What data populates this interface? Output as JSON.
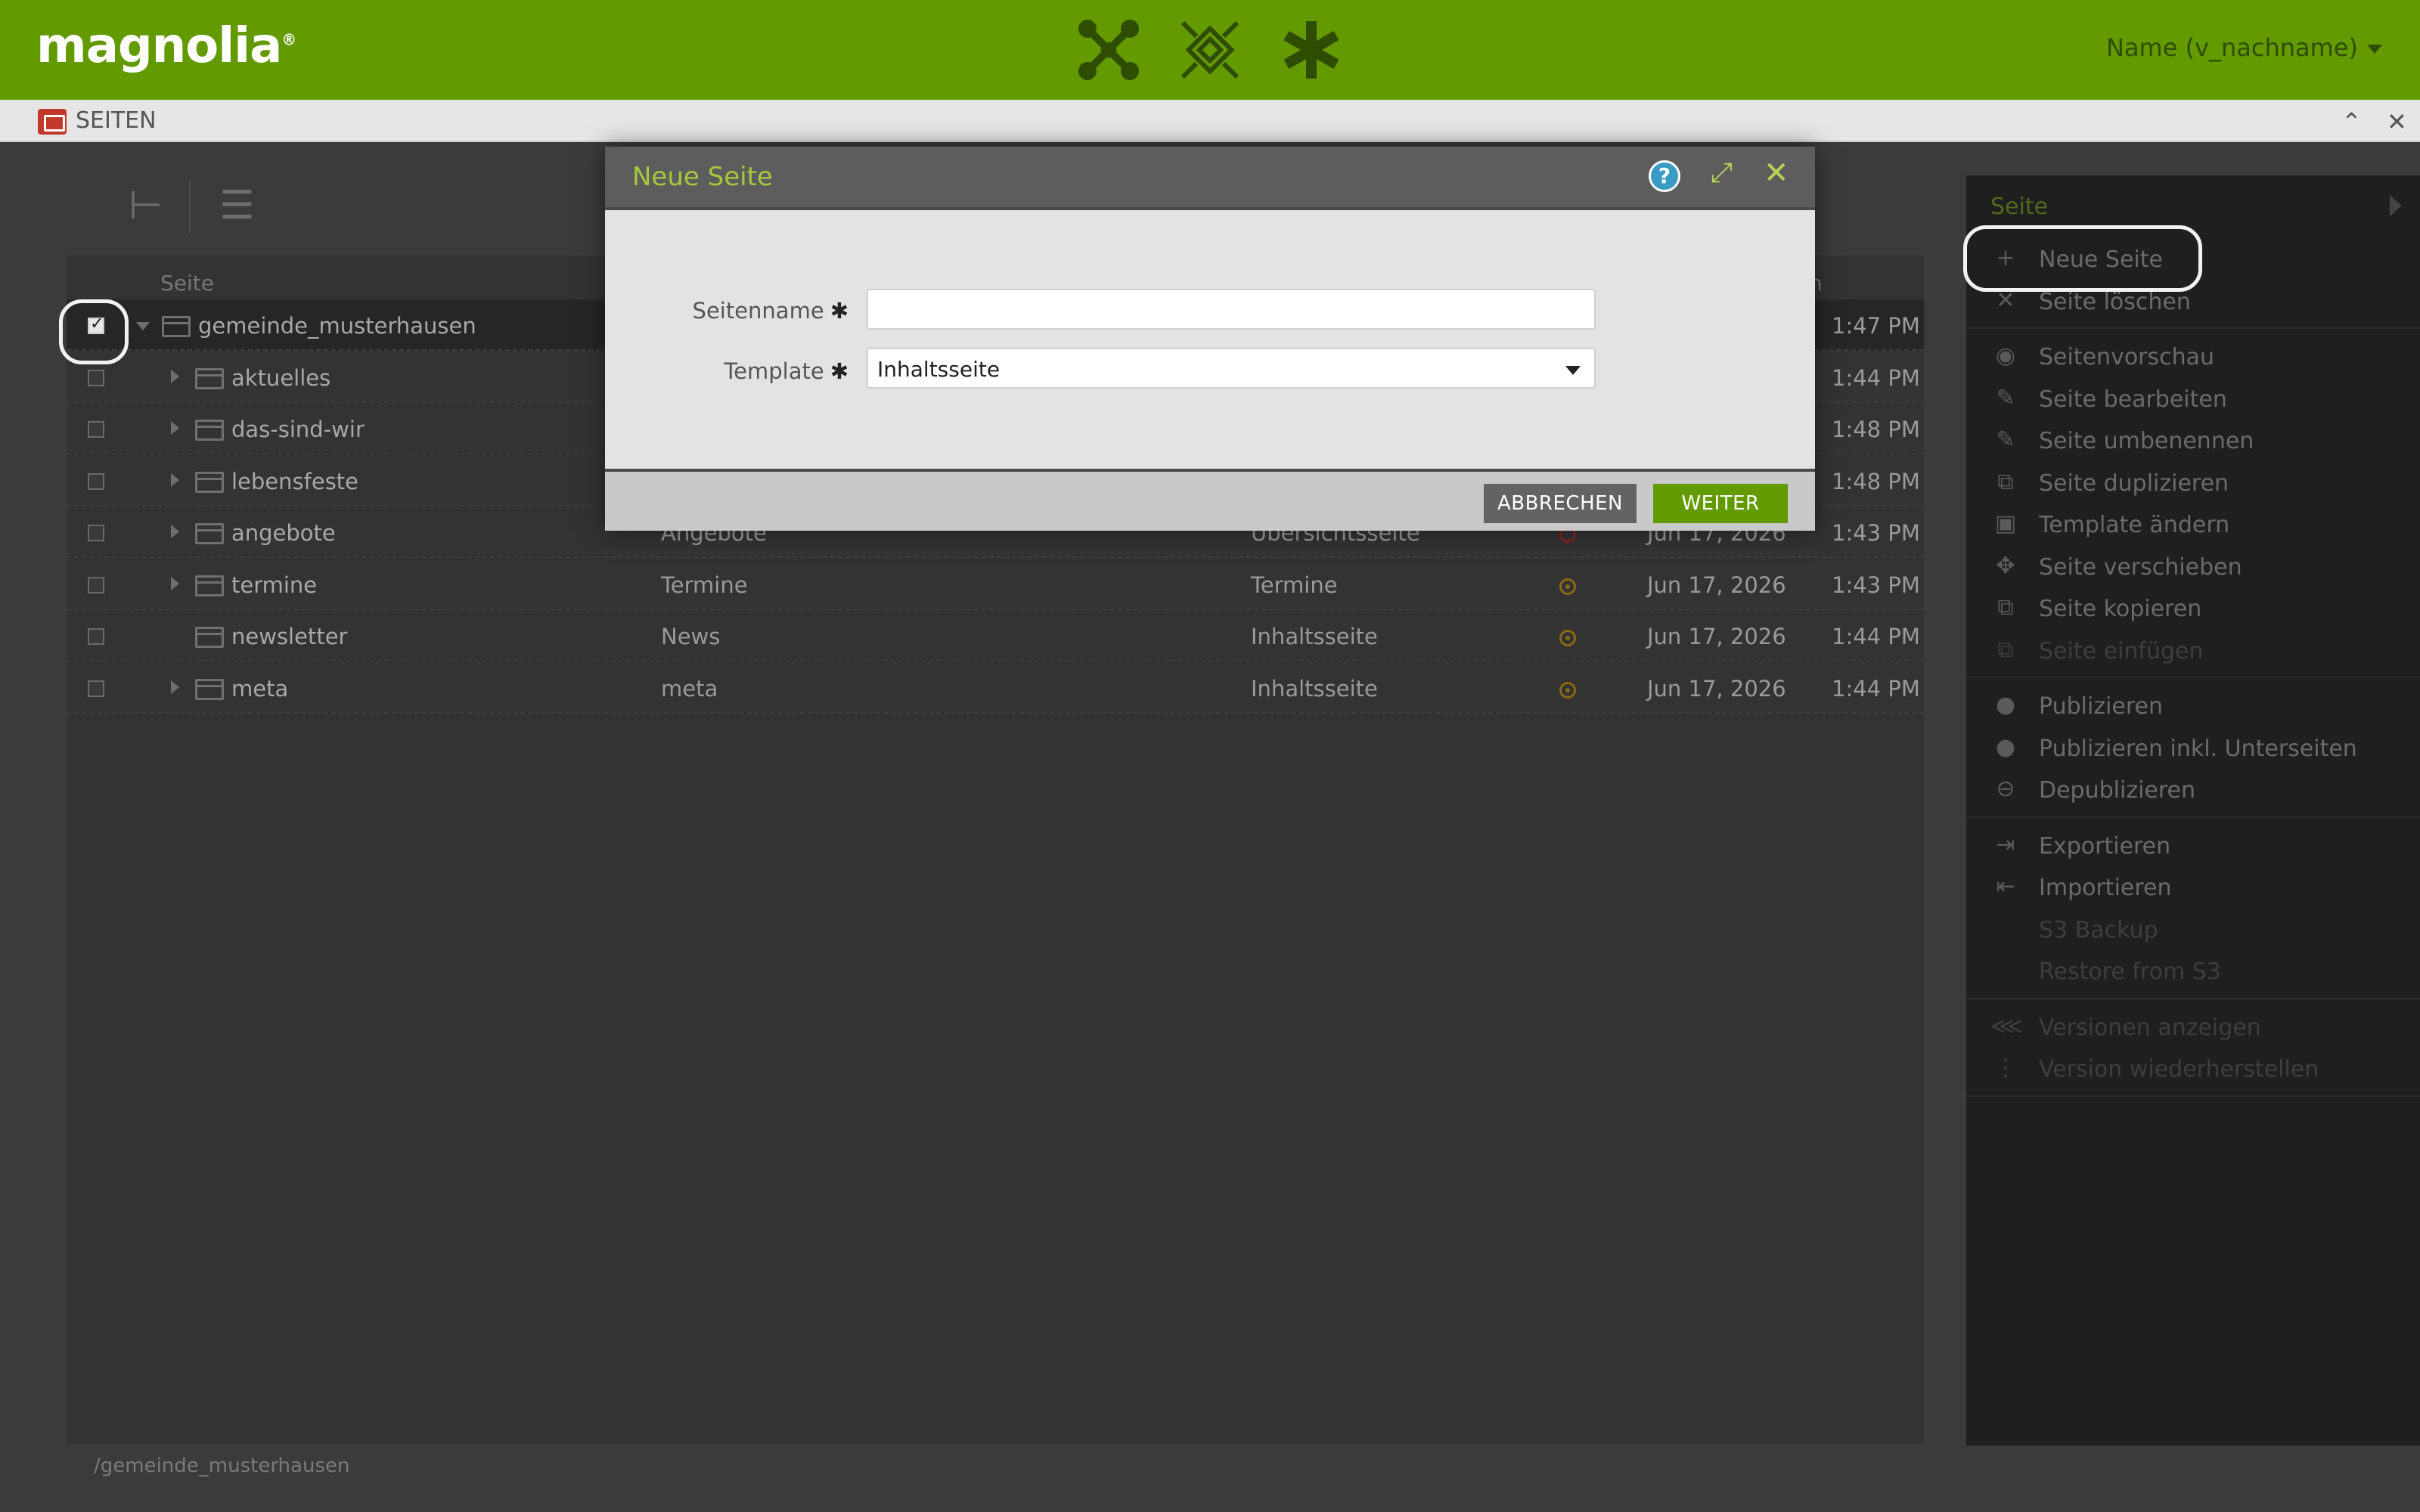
{
  "header": {
    "logo": "magnolia",
    "logo_mark": "®",
    "user_name": "Name (v_nachname)",
    "colors": {
      "brand": "#629a00",
      "accent": "#a6c93b"
    }
  },
  "appbar": {
    "title": "SEITEN",
    "collapse_glyph": "⌃",
    "close_glyph": "✕"
  },
  "toolbar": {
    "tree_view_glyph": "⊢",
    "list_view_glyph": "☰"
  },
  "grid": {
    "columns": {
      "page": "Seite",
      "right_fragment": "n"
    },
    "rows": [
      {
        "name": "gemeinde_musterhausen",
        "title": "",
        "template": "",
        "status": "",
        "date": "",
        "time": "1:47 PM",
        "selected": true
      },
      {
        "name": "aktuelles",
        "title": "",
        "template": "",
        "status": "",
        "date": "",
        "time": "1:44 PM",
        "selected": false
      },
      {
        "name": "das-sind-wir",
        "title": "",
        "template": "",
        "status": "",
        "date": "",
        "time": "1:48 PM",
        "selected": false
      },
      {
        "name": "lebensfeste",
        "title": "",
        "template": "",
        "status": "",
        "date": "",
        "time": "1:48 PM",
        "selected": false
      },
      {
        "name": "angebote",
        "title": "Angebote",
        "template": "Übersichtsseite",
        "status": "red",
        "date": "Jun 17, 2026",
        "time": "1:43 PM",
        "selected": false
      },
      {
        "name": "termine",
        "title": "Termine",
        "template": "Termine",
        "status": "orange",
        "date": "Jun 17, 2026",
        "time": "1:43 PM",
        "selected": false
      },
      {
        "name": "newsletter",
        "title": "News",
        "template": "Inhaltsseite",
        "status": "orange",
        "date": "Jun 17, 2026",
        "time": "1:44 PM",
        "selected": false
      },
      {
        "name": "meta",
        "title": "meta",
        "template": "Inhaltsseite",
        "status": "orange",
        "date": "Jun 17, 2026",
        "time": "1:44 PM",
        "selected": false
      }
    ]
  },
  "path": "/gemeinde_musterhausen",
  "actionbar": {
    "title": "Seite",
    "groups": [
      [
        {
          "label": "Neue Seite",
          "icon": "+"
        },
        {
          "label": "Seite löschen",
          "icon": "✕"
        }
      ],
      [
        {
          "label": "Seitenvorschau",
          "icon": "◉"
        },
        {
          "label": "Seite bearbeiten",
          "icon": "✎"
        },
        {
          "label": "Seite umbenennen",
          "icon": "✎"
        },
        {
          "label": "Seite duplizieren",
          "icon": "⧉"
        },
        {
          "label": "Template ändern",
          "icon": "▣"
        },
        {
          "label": "Seite verschieben",
          "icon": "✥"
        },
        {
          "label": "Seite kopieren",
          "icon": "⧉"
        },
        {
          "label": "Seite einfügen",
          "icon": "⧉",
          "disabled": true
        }
      ],
      [
        {
          "label": "Publizieren",
          "icon": "●"
        },
        {
          "label": "Publizieren inkl. Unterseiten",
          "icon": "●"
        },
        {
          "label": "Depublizieren",
          "icon": "⊖"
        }
      ],
      [
        {
          "label": "Exportieren",
          "icon": "⇥"
        },
        {
          "label": "Importieren",
          "icon": "⇤"
        },
        {
          "label": "S3 Backup",
          "icon": "",
          "disabled": true
        },
        {
          "label": "Restore from S3",
          "icon": "",
          "disabled": true
        }
      ],
      [
        {
          "label": "Versionen anzeigen",
          "icon": "⋘",
          "disabled": true
        },
        {
          "label": "Version wiederherstellen",
          "icon": "⋮",
          "disabled": true
        }
      ]
    ]
  },
  "modal": {
    "title": "Neue Seite",
    "help_glyph": "?",
    "expand_glyph": "⤢",
    "close_glyph": "✕",
    "required_marker": "✱",
    "fields": {
      "name_label": "Seitenname",
      "name_value": "",
      "template_label": "Template",
      "template_value": "Inhaltsseite"
    },
    "buttons": {
      "cancel": "ABBRECHEN",
      "next": "WEITER"
    }
  }
}
